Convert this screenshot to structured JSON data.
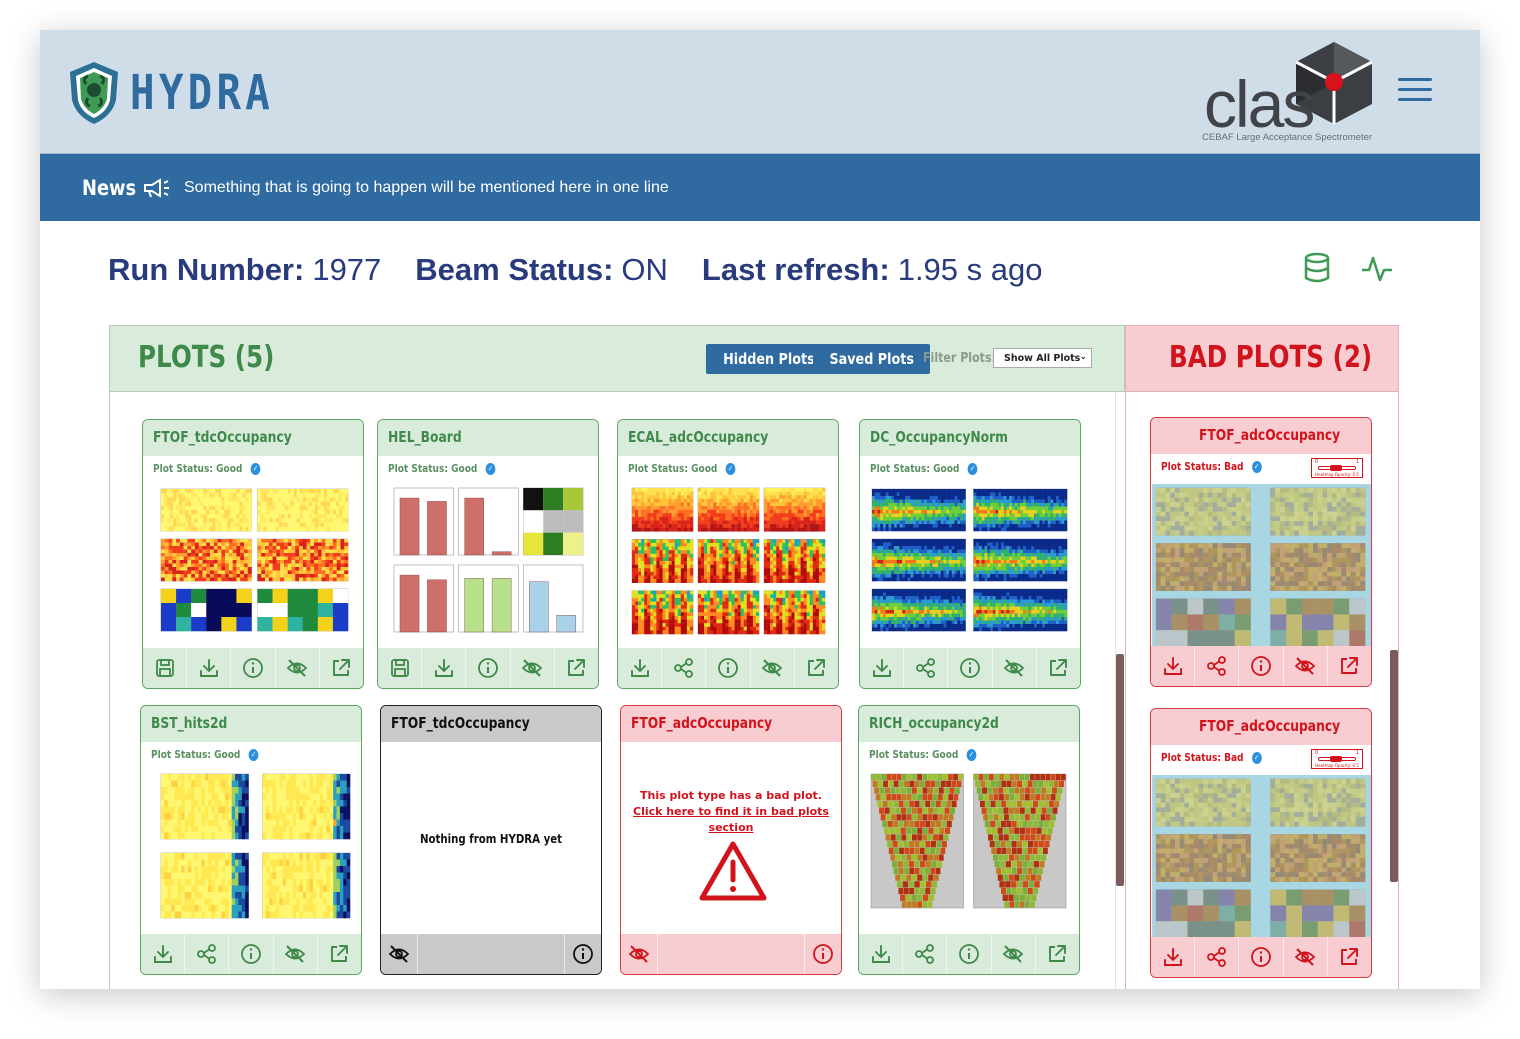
{
  "app": {
    "logo_text": "HYDRA",
    "partner_logo_text": "clas",
    "partner_logo_subtitle": "CEBAF Large Acceptance Spectrometer"
  },
  "news": {
    "title": "News",
    "message": "Something that is going to happen will be mentioned here in one line"
  },
  "status": {
    "run_label": "Run Number:",
    "run_value": "1977",
    "beam_label": "Beam Status:",
    "beam_value": "ON",
    "refresh_label": "Last refresh:",
    "refresh_value": "1.95 s ago"
  },
  "plots": {
    "title": "PLOTS (5)",
    "hidden_button": "Hidden Plots",
    "saved_button": "Saved Plots",
    "filter_label": "Filter Plots:",
    "filter_value": "Show All Plots",
    "cards": [
      {
        "title": "FTOF_tdcOccupancy",
        "status": "Plot Status: Good"
      },
      {
        "title": "HEL_Board",
        "status": "Plot Status: Good"
      },
      {
        "title": "ECAL_adcOccupancy",
        "status": "Plot Status: Good"
      },
      {
        "title": "DC_OccupancyNorm",
        "status": "Plot Status: Good"
      },
      {
        "title": "BST_hits2d",
        "status": "Plot Status: Good"
      },
      {
        "title": "FTOF_tdcOccupancy",
        "message": "Nothing from HYDRA yet"
      },
      {
        "title": "FTOF_adcOccupancy",
        "message_line1": "This plot type has a bad plot.",
        "message_line2": "Click here to find it in bad plots",
        "message_line3": "section"
      },
      {
        "title": "RICH_occupancy2d",
        "status": "Plot Status: Good"
      }
    ]
  },
  "bad_plots": {
    "title": "BAD PLOTS (2)",
    "cards": [
      {
        "title": "FTOF_adcOccupancy",
        "status": "Plot Status: Bad",
        "opacity_label": "Heatmap Opacity: 0.5",
        "opacity_value": 0.5,
        "range_min": "0",
        "range_max": "1"
      },
      {
        "title": "FTOF_adcOccupancy",
        "status": "Plot Status: Bad",
        "opacity_label": "Heatmap Opacity: 0.5",
        "opacity_value": 0.5,
        "range_min": "0",
        "range_max": "1"
      }
    ]
  },
  "colors": {
    "brand_blue": "#2f6aa1",
    "header_bg": "#cfdde9",
    "good_green": "#3f8a4a",
    "good_bg": "#d9ebdb",
    "bad_red": "#d1131c",
    "bad_bg": "#f8cdd2",
    "run_text": "#293a7d"
  },
  "icons": [
    "save-icon",
    "download-icon",
    "share-icon",
    "info-icon",
    "hide-icon",
    "external-link-icon",
    "warning-icon",
    "database-icon",
    "activity-icon",
    "megaphone-icon",
    "menu-icon",
    "check-badge-icon"
  ]
}
